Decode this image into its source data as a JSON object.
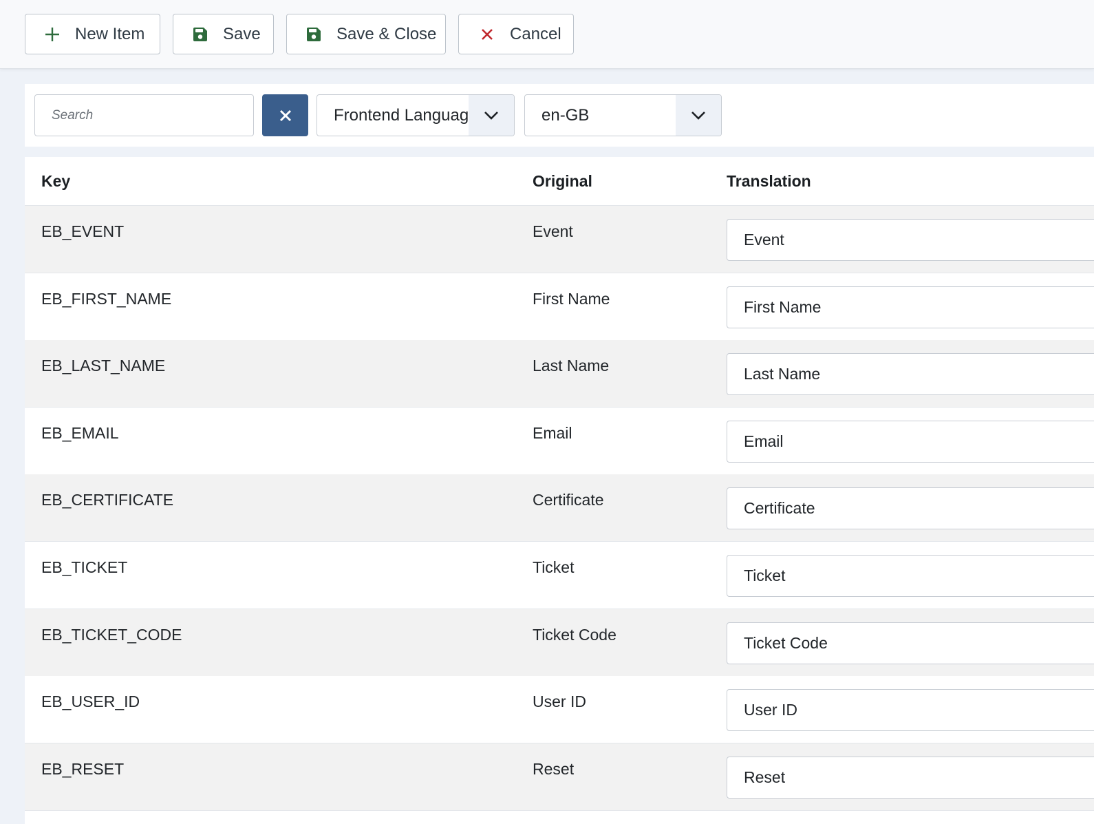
{
  "toolbar": {
    "new_item": "New Item",
    "save": "Save",
    "save_close": "Save & Close",
    "cancel": "Cancel"
  },
  "filters": {
    "search_placeholder": "Search",
    "search_value": "",
    "language_selected": "Frontend Language",
    "locale_selected": "en-GB"
  },
  "table": {
    "headers": {
      "key": "Key",
      "original": "Original",
      "translation": "Translation"
    },
    "rows": [
      {
        "key": "EB_EVENT",
        "original": "Event",
        "translation": "Event"
      },
      {
        "key": "EB_FIRST_NAME",
        "original": "First Name",
        "translation": "First Name"
      },
      {
        "key": "EB_LAST_NAME",
        "original": "Last Name",
        "translation": "Last Name"
      },
      {
        "key": "EB_EMAIL",
        "original": "Email",
        "translation": "Email"
      },
      {
        "key": "EB_CERTIFICATE",
        "original": "Certificate",
        "translation": "Certificate"
      },
      {
        "key": "EB_TICKET",
        "original": "Ticket",
        "translation": "Ticket"
      },
      {
        "key": "EB_TICKET_CODE",
        "original": "Ticket Code",
        "translation": "Ticket Code"
      },
      {
        "key": "EB_USER_ID",
        "original": "User ID",
        "translation": "User ID"
      },
      {
        "key": "EB_RESET",
        "original": "Reset",
        "translation": "Reset"
      }
    ]
  },
  "colors": {
    "save_icon": "#2e6b3c",
    "new_icon": "#2e6b3c",
    "cancel_icon": "#c0282d",
    "clear_button": "#3a5e8c"
  },
  "icons": {
    "new_item": "plus-icon",
    "save": "floppy-disk-icon",
    "save_close": "floppy-disk-icon",
    "cancel": "close-icon",
    "clear": "close-icon",
    "select": "chevron-down-icon"
  }
}
